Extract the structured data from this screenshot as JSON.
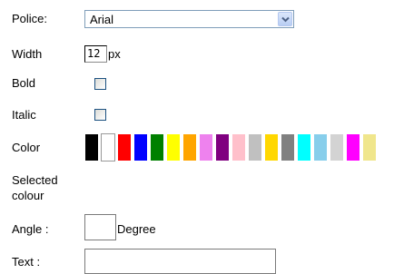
{
  "police": {
    "label": "Police:",
    "selected": "Arial",
    "dropdown_icon": "chevron-down-icon",
    "border_color": "#7f9db9"
  },
  "width": {
    "label": "Width",
    "value": "12",
    "unit": "px"
  },
  "bold": {
    "label": "Bold",
    "checked": false
  },
  "italic": {
    "label": "Italic",
    "checked": false
  },
  "color": {
    "label": "Color",
    "swatches": [
      "#000000",
      "#ffffff",
      "#ff0000",
      "#0000ff",
      "#008000",
      "#ffff00",
      "#ffa500",
      "#ee82ee",
      "#800080",
      "#ffc0cb",
      "#c0c0c0",
      "#ffd700",
      "#808080",
      "#00ffff",
      "#87ceeb",
      "#d3d3d3",
      "#ff00ff",
      "#f0e68c"
    ]
  },
  "selected_colour": {
    "label_line1": "Selected",
    "label_line2": "colour"
  },
  "angle": {
    "label": "Angle :",
    "value": "",
    "unit": "Degree"
  },
  "text": {
    "label": "Text :",
    "value": ""
  }
}
